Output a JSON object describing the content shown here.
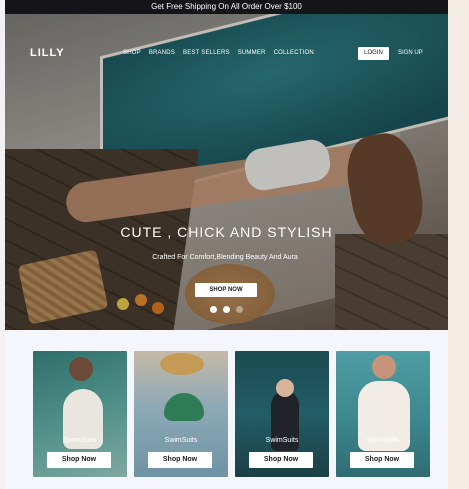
{
  "announcement": "Get Free Shipping On All Order Over $100",
  "header": {
    "brand": "LILLY",
    "nav": [
      "SHOP",
      "BRANDS",
      "BEST SELLERS",
      "SUMMER",
      "COLLECTION"
    ],
    "login_label": "LOGIN",
    "signup_label": "SIGN UP"
  },
  "hero": {
    "headline": "CUTE , CHICK AND STYLISH",
    "subline": "Crafted For Comfort,Blending Beauty And Aura",
    "cta_label": "SHOP NOW",
    "slides": 3,
    "active_slide": 2
  },
  "products": [
    {
      "label": "SwimSuits",
      "button": "Shop Now"
    },
    {
      "label": "SwimSuits",
      "button": "Shop Now"
    },
    {
      "label": "SwimSuits",
      "button": "Shop Now"
    },
    {
      "label": "SwimSuits",
      "button": "Shop Now"
    }
  ],
  "colors": {
    "announcement_bg": "#151419",
    "page_bg": "#f4f6fb",
    "pool": "#2f7f85"
  }
}
